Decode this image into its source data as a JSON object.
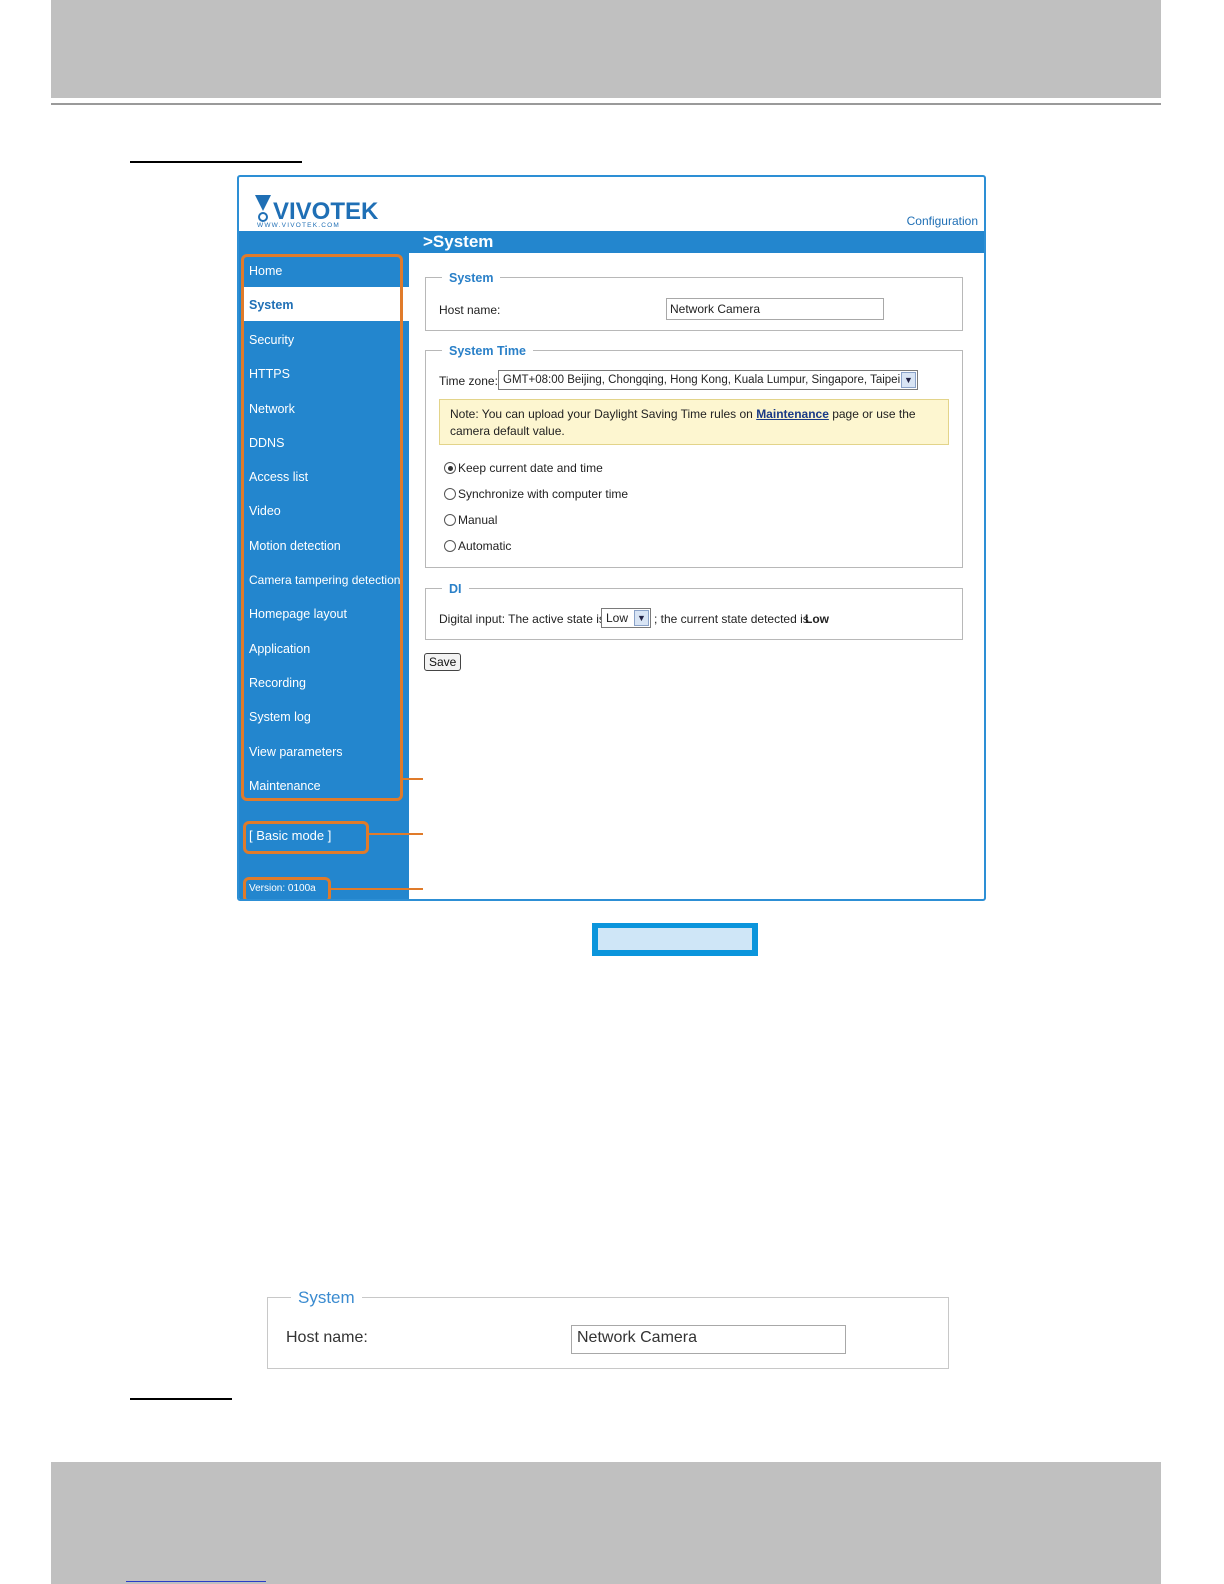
{
  "page": {
    "top_band": "",
    "bottom_band": ""
  },
  "camera_ui": {
    "brand": "VIVOTEK",
    "brand_url": "WWW.VIVOTEK.COM",
    "config_link": "Configuration",
    "page_title": ">System",
    "nav_items": [
      "Home",
      "System",
      "Security",
      "HTTPS",
      "Network",
      "DDNS",
      "Access list",
      "Video",
      "Motion detection",
      "Camera tampering detection",
      "Homepage layout",
      "Application",
      "Recording",
      "System log",
      "View parameters",
      "Maintenance"
    ],
    "selected_nav": "System",
    "basic_mode": "[ Basic mode ]",
    "version": "Version: 0100a",
    "system_group": {
      "legend": "System",
      "host_label": "Host name:",
      "host_value": "Network Camera"
    },
    "time_group": {
      "legend": "System Time",
      "tz_label": "Time zone:",
      "tz_value": "GMT+08:00 Beijing, Chongqing, Hong Kong, Kuala Lumpur, Singapore, Taipei",
      "note_prefix": "Note: You can upload your Daylight Saving Time rules on ",
      "note_link": "Maintenance",
      "note_suffix": " page or use the camera default value.",
      "options": [
        "Keep current date and time",
        "Synchronize with computer time",
        "Manual",
        "Automatic"
      ],
      "selected_option": "Keep current date and time"
    },
    "di_group": {
      "legend": "DI",
      "text_before": "Digital input: The active state is",
      "active_state": "Low",
      "text_after": "; the current state detected is",
      "current_state": "Low"
    },
    "save_button": "Save",
    "colors": {
      "sidebar": "#2386ce",
      "accent": "#2a80c8",
      "highlight": "#e07b2a"
    }
  },
  "enlarged": {
    "legend": "System",
    "host_label": "Host name:",
    "host_value": "Network Camera"
  }
}
